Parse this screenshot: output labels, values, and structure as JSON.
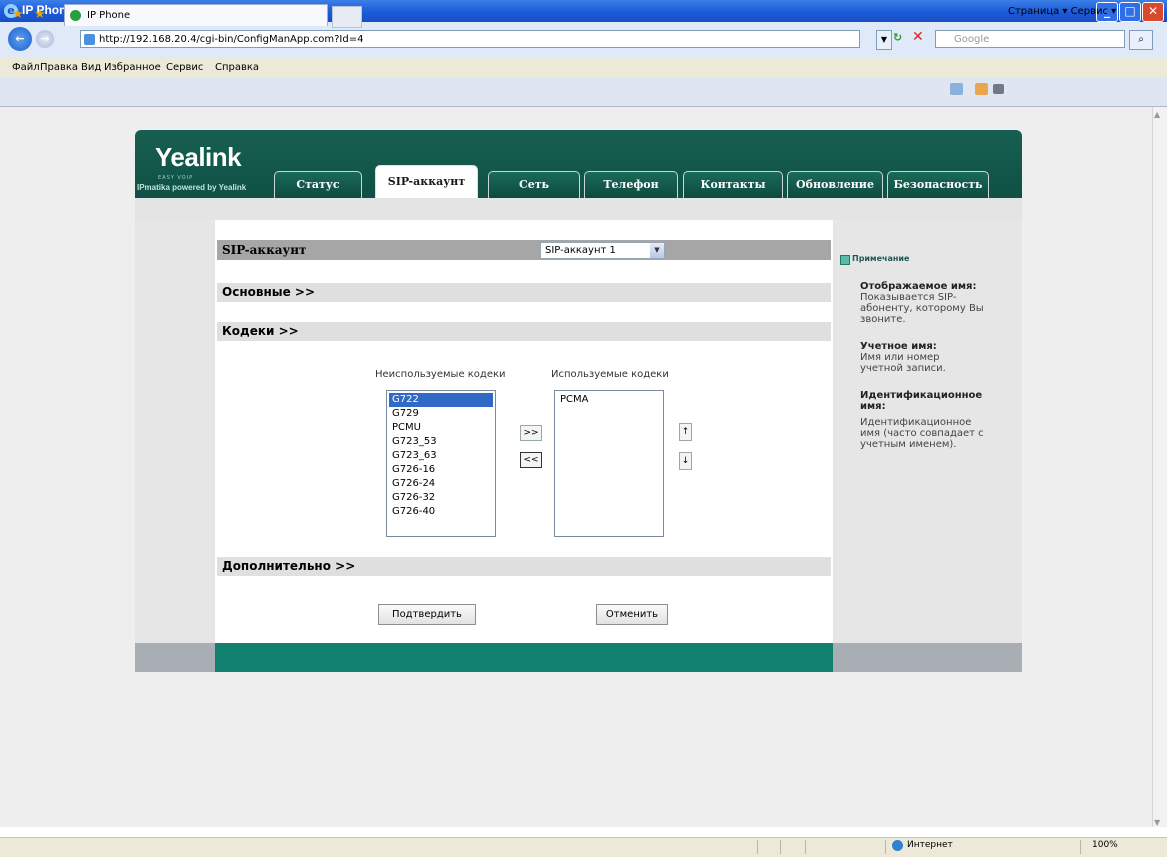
{
  "window": {
    "title": "IP Phone - Windows Internet Explorer",
    "min": "_",
    "max": "□",
    "close": "✕"
  },
  "address": {
    "url": "http://192.168.20.4/cgi-bin/ConfigManApp.com?Id=4",
    "search_placeholder": "Google",
    "back": "←",
    "forward": "→",
    "refresh": "↻",
    "stop": "✕",
    "search_glyph": "⌕"
  },
  "menu": [
    "Файл",
    "Правка",
    "Вид",
    "Избранное",
    "Сервис",
    "Справка"
  ],
  "tab": {
    "title": "IP Phone"
  },
  "command_bar": "Страница ▾   Сервис ▾",
  "brand": {
    "logo": "Yealink",
    "sub": "EASY VOIP",
    "tagline": "IPmatika powered by Yealink"
  },
  "nav_tabs": [
    "Статус",
    "SIP-аккаунт",
    "Сеть",
    "Телефон",
    "Контакты",
    "Обновление",
    "Безопасность"
  ],
  "sections": {
    "sip_account": "SIP-аккаунт",
    "basic": "Основные >>",
    "codecs": "Кодеки >>",
    "advanced": "Дополнительно >>"
  },
  "account_select": {
    "value": "SIP-аккаунт 1",
    "arrow": "▼"
  },
  "codecs": {
    "unused_label": "Неиспользуемые кодеки",
    "used_label": "Используемые кодеки",
    "unused": [
      "G722",
      "G729",
      "PCMU",
      "G723_53",
      "G723_63",
      "G726-16",
      "G726-24",
      "G726-32",
      "G726-40"
    ],
    "unused_selected": "G722",
    "used": [
      "PCMA"
    ],
    "btn_add": ">>",
    "btn_remove": "<<",
    "btn_up": "↑",
    "btn_down": "↓"
  },
  "buttons": {
    "confirm": "Подтвердить",
    "cancel": "Отменить"
  },
  "note": {
    "title": "Примечание",
    "items": [
      {
        "heading": "Отображаемое имя:",
        "text": "Показывается SIP-абоненту, которому Вы звоните."
      },
      {
        "heading": "Учетное имя:",
        "text": "Имя или номер учетной записи."
      },
      {
        "heading": "Идентификационное имя:",
        "text": "Идентификационное имя (часто совпадает с учетным именем)."
      }
    ]
  },
  "status": {
    "zone": "Интернет",
    "zoom": "100%"
  },
  "colors": {
    "brand_green": "#0f5144",
    "footer_teal": "#11806f",
    "selection": "#3169c6"
  }
}
